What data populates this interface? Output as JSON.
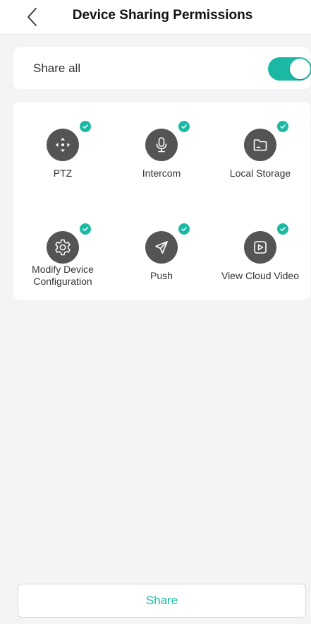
{
  "header": {
    "title": "Device Sharing Permissions",
    "back_icon": "chevron-left-icon"
  },
  "share_all": {
    "label": "Share all",
    "enabled": true
  },
  "permissions": [
    {
      "label": "PTZ",
      "icon": "ptz-icon",
      "checked": true
    },
    {
      "label": "Intercom",
      "icon": "microphone-icon",
      "checked": true
    },
    {
      "label": "Local Storage",
      "icon": "folder-icon",
      "checked": true
    },
    {
      "label": "Modify Device Configuration",
      "icon": "gear-icon",
      "checked": true
    },
    {
      "label": "Push",
      "icon": "send-icon",
      "checked": true
    },
    {
      "label": "View Cloud Video",
      "icon": "play-icon",
      "checked": true
    }
  ],
  "footer": {
    "share_label": "Share"
  },
  "colors": {
    "accent": "#1bb9a4",
    "icon_bg": "#545454",
    "background": "#f4f3f5"
  }
}
